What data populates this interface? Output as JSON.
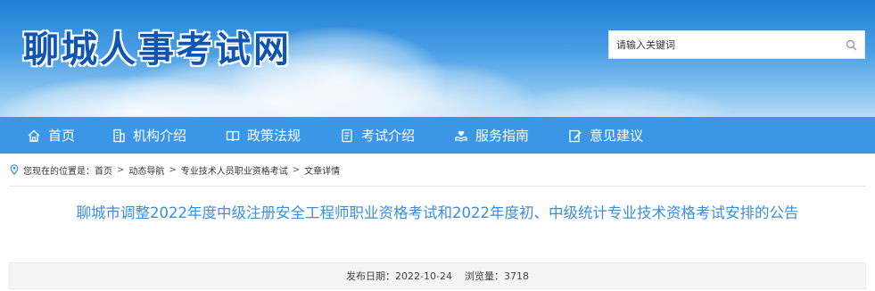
{
  "header": {
    "site_title": "聊城人事考试网",
    "search": {
      "placeholder": "请输入关键词",
      "icon": "search-icon"
    }
  },
  "nav": {
    "items": [
      {
        "label": "首页",
        "icon": "home-icon"
      },
      {
        "label": "机构介绍",
        "icon": "building-icon"
      },
      {
        "label": "政策法规",
        "icon": "book-icon"
      },
      {
        "label": "考试介绍",
        "icon": "document-icon"
      },
      {
        "label": "服务指南",
        "icon": "heart-hand-icon"
      },
      {
        "label": "意见建议",
        "icon": "edit-icon"
      }
    ]
  },
  "breadcrumb": {
    "prefix": "您现在的位置是：",
    "items": [
      "首页",
      "动态导航",
      "专业技术人员职业资格考试",
      "文章详情"
    ],
    "separator": ">"
  },
  "article": {
    "title": "聊城市调整2022年度中级注册安全工程师职业资格考试和2022年度初、中级统计专业技术资格考试安排的公告",
    "publish_label": "发布日期：",
    "publish_date": "2022-10-24",
    "views_label": "浏览量：",
    "views": "3718"
  },
  "colors": {
    "nav_bg": "#3c96e8",
    "title_blue": "#0f55b4",
    "article_title": "#3a8fdc"
  }
}
